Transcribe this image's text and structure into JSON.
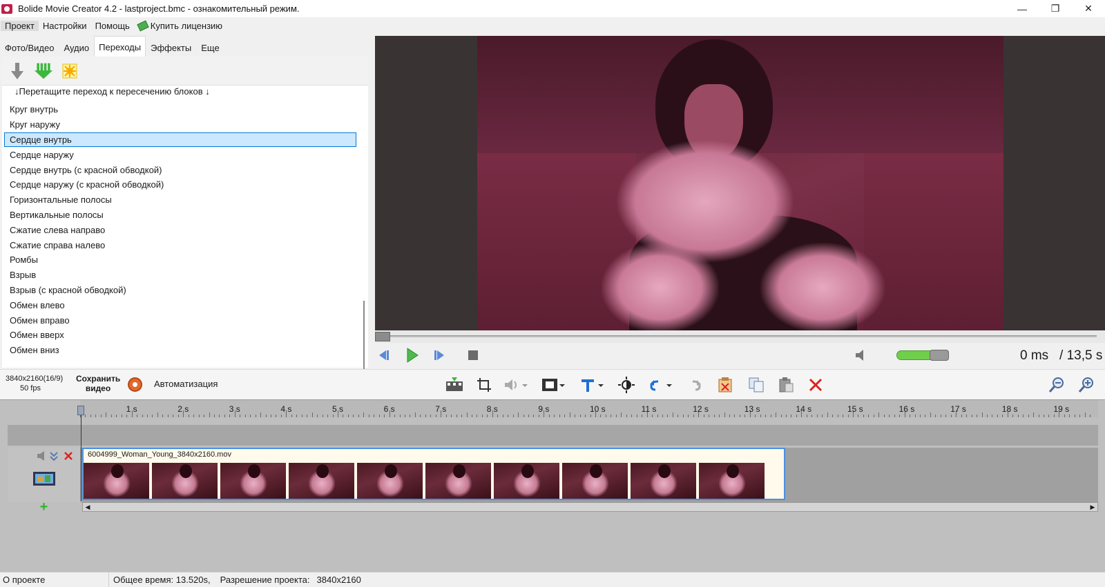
{
  "window": {
    "title": "Bolide Movie Creator 4.2 - lastproject.bmc  - ознакомительный режим.",
    "minimize": "—",
    "maximize": "❐",
    "close": "✕"
  },
  "menu": {
    "items": [
      "Проект",
      "Настройки",
      "Помощь"
    ],
    "buy_license": "Купить лицензию"
  },
  "tabs": [
    "Фото/Видео",
    "Аудио",
    "Переходы",
    "Эффекты",
    "Еще"
  ],
  "active_tab": "Переходы",
  "transitions": {
    "hint": "↓Перетащите переход к пересечению блоков ↓",
    "selected": "Сердце внутрь",
    "items": [
      "Круг внутрь",
      "Круг наружу",
      "Сердце внутрь",
      "Сердце наружу",
      "Сердце внутрь  (с красной обводкой)",
      "Сердце наружу (с красной обводкой)",
      "Горизонтальные полосы",
      "Вертикальные полосы",
      "Сжатие слева направо",
      "Сжатие справа налево",
      "Ромбы",
      "Взрыв",
      "Взрыв (с красной обводкой)",
      "Обмен влево",
      "Обмен вправо",
      "Обмен вверх",
      "Обмен вниз"
    ]
  },
  "player": {
    "current_time": "0 ms",
    "total_time": "/ 13,5 s",
    "volume_level": 0.75,
    "seek_position": 0
  },
  "toolbar": {
    "resolution": "3840x2160(16/9)",
    "fps": "50 fps",
    "save_video_line1": "Сохранить",
    "save_video_line2": "видео",
    "automation": "Автоматизация"
  },
  "timeline": {
    "ruler_labels": [
      "1 s",
      "2 s",
      "3 s",
      "4 s",
      "5 s",
      "6 s",
      "7 s",
      "8 s",
      "9 s",
      "10 s",
      "11 s",
      "12 s",
      "13 s",
      "14 s",
      "15 s",
      "16 s",
      "17 s",
      "18 s",
      "19 s"
    ],
    "clip_name": "6004999_Woman_Young_3840x2160.mov",
    "thumbnail_count": 10,
    "add_track": "+"
  },
  "status": {
    "about": "О проекте",
    "total_time": "Общее время: 13.520s,",
    "resolution_label": "Разрешение проекта:",
    "resolution_value": "3840x2160"
  },
  "colors": {
    "selection_bg": "#cce8ff",
    "selection_border": "#0078d7",
    "clip_border": "#4a90e2",
    "volume": "#6fcf4a"
  }
}
